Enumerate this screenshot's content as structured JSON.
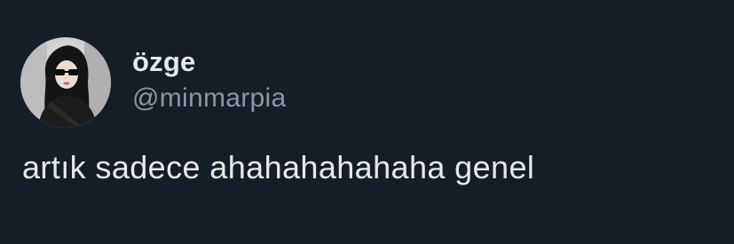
{
  "tweet": {
    "author": {
      "display_name": "özge",
      "handle": "@minmarpia",
      "avatar_icon": "profile-photo"
    },
    "text": "artık sadece ahahahahahaha genel"
  },
  "colors": {
    "background": "#151d28",
    "primary_text": "#e7e9ea",
    "secondary_text": "#8b98a5"
  }
}
